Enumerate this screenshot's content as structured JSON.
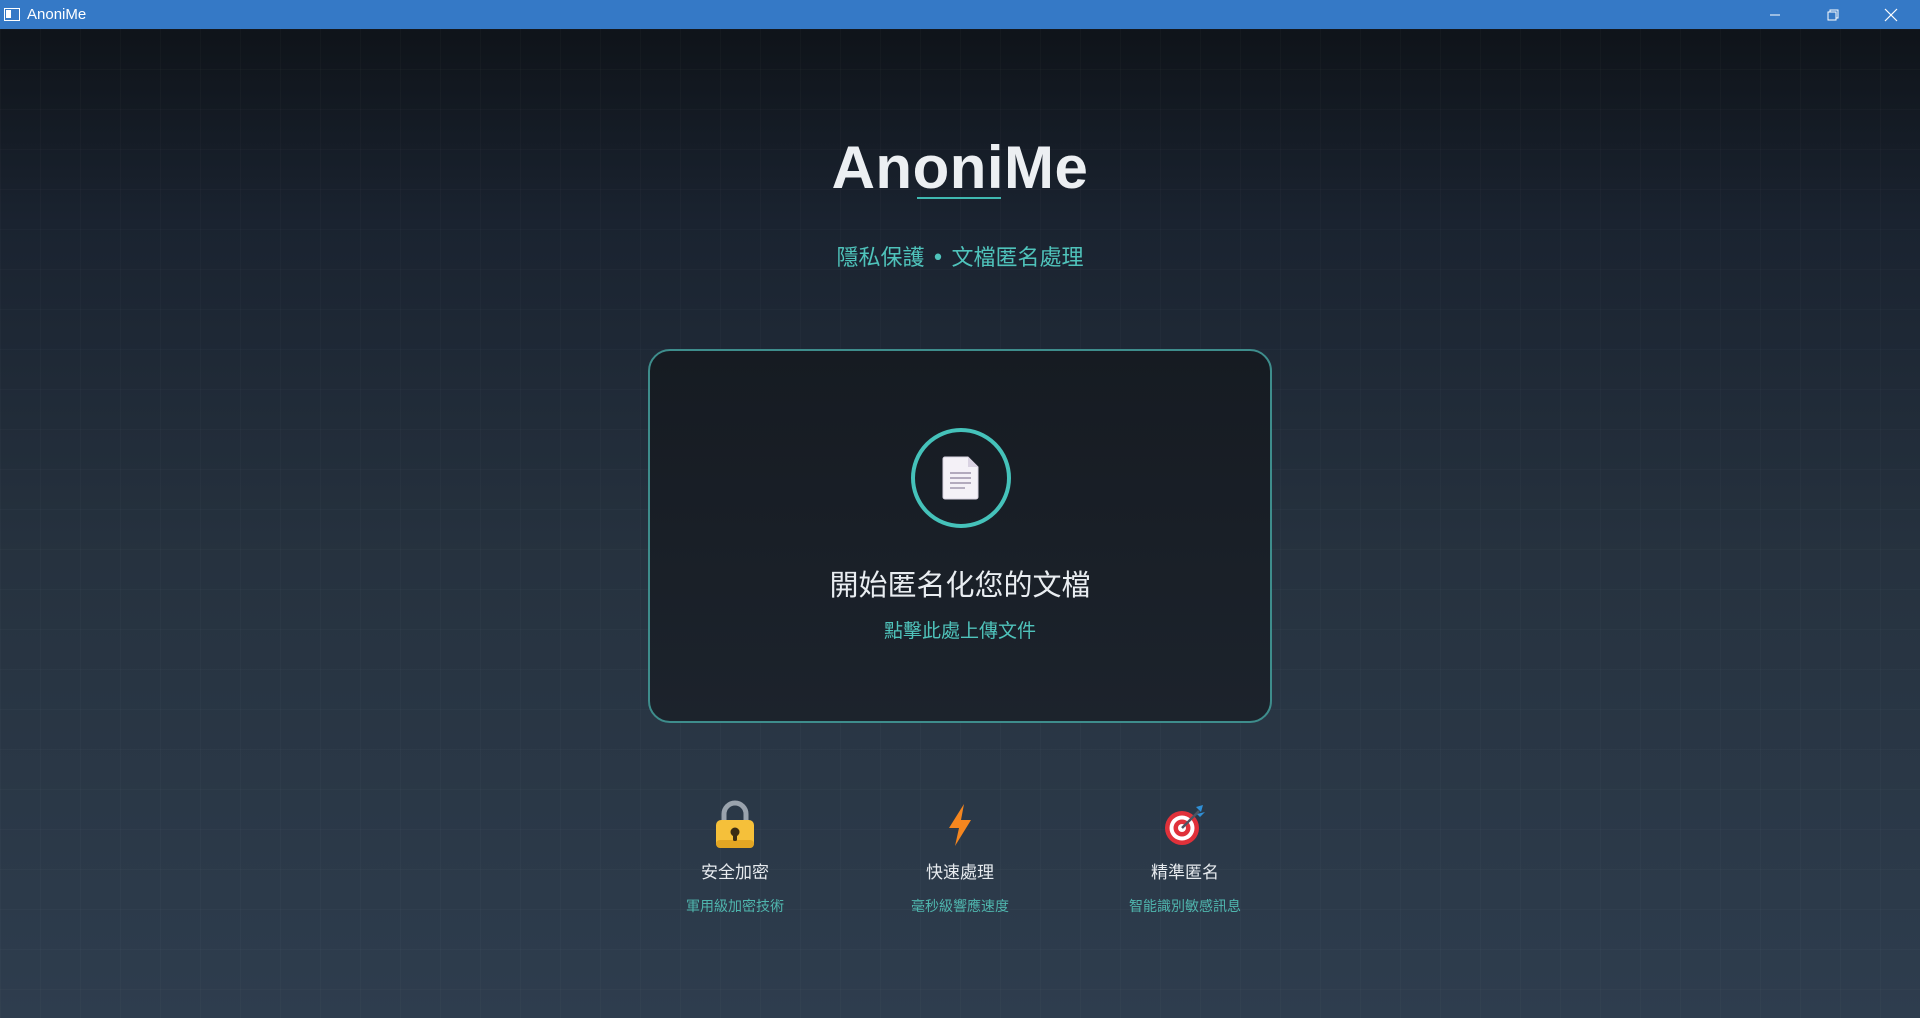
{
  "window": {
    "title": "AnoniMe",
    "icons": {
      "app": "app-icon",
      "minimize": "minimize-icon",
      "restore": "restore-icon",
      "close": "close-icon"
    }
  },
  "header": {
    "brand": "AnoniMe",
    "tagline": "隱私保護 • 文檔匿名處理"
  },
  "upload": {
    "icon": "document-icon",
    "title": "開始匿名化您的文檔",
    "subtitle": "點擊此處上傳文件"
  },
  "features": [
    {
      "icon": "lock-icon",
      "title": "安全加密",
      "subtitle": "軍用級加密技術"
    },
    {
      "icon": "lightning-icon",
      "title": "快速處理",
      "subtitle": "毫秒級響應速度"
    },
    {
      "icon": "target-icon",
      "title": "精準匿名",
      "subtitle": "智能識別敏感訊息"
    }
  ],
  "colors": {
    "titlebar": "#3579c6",
    "accent": "#45c2ba",
    "background_top": "#0d1116",
    "background_bottom": "#2e3d4e"
  }
}
